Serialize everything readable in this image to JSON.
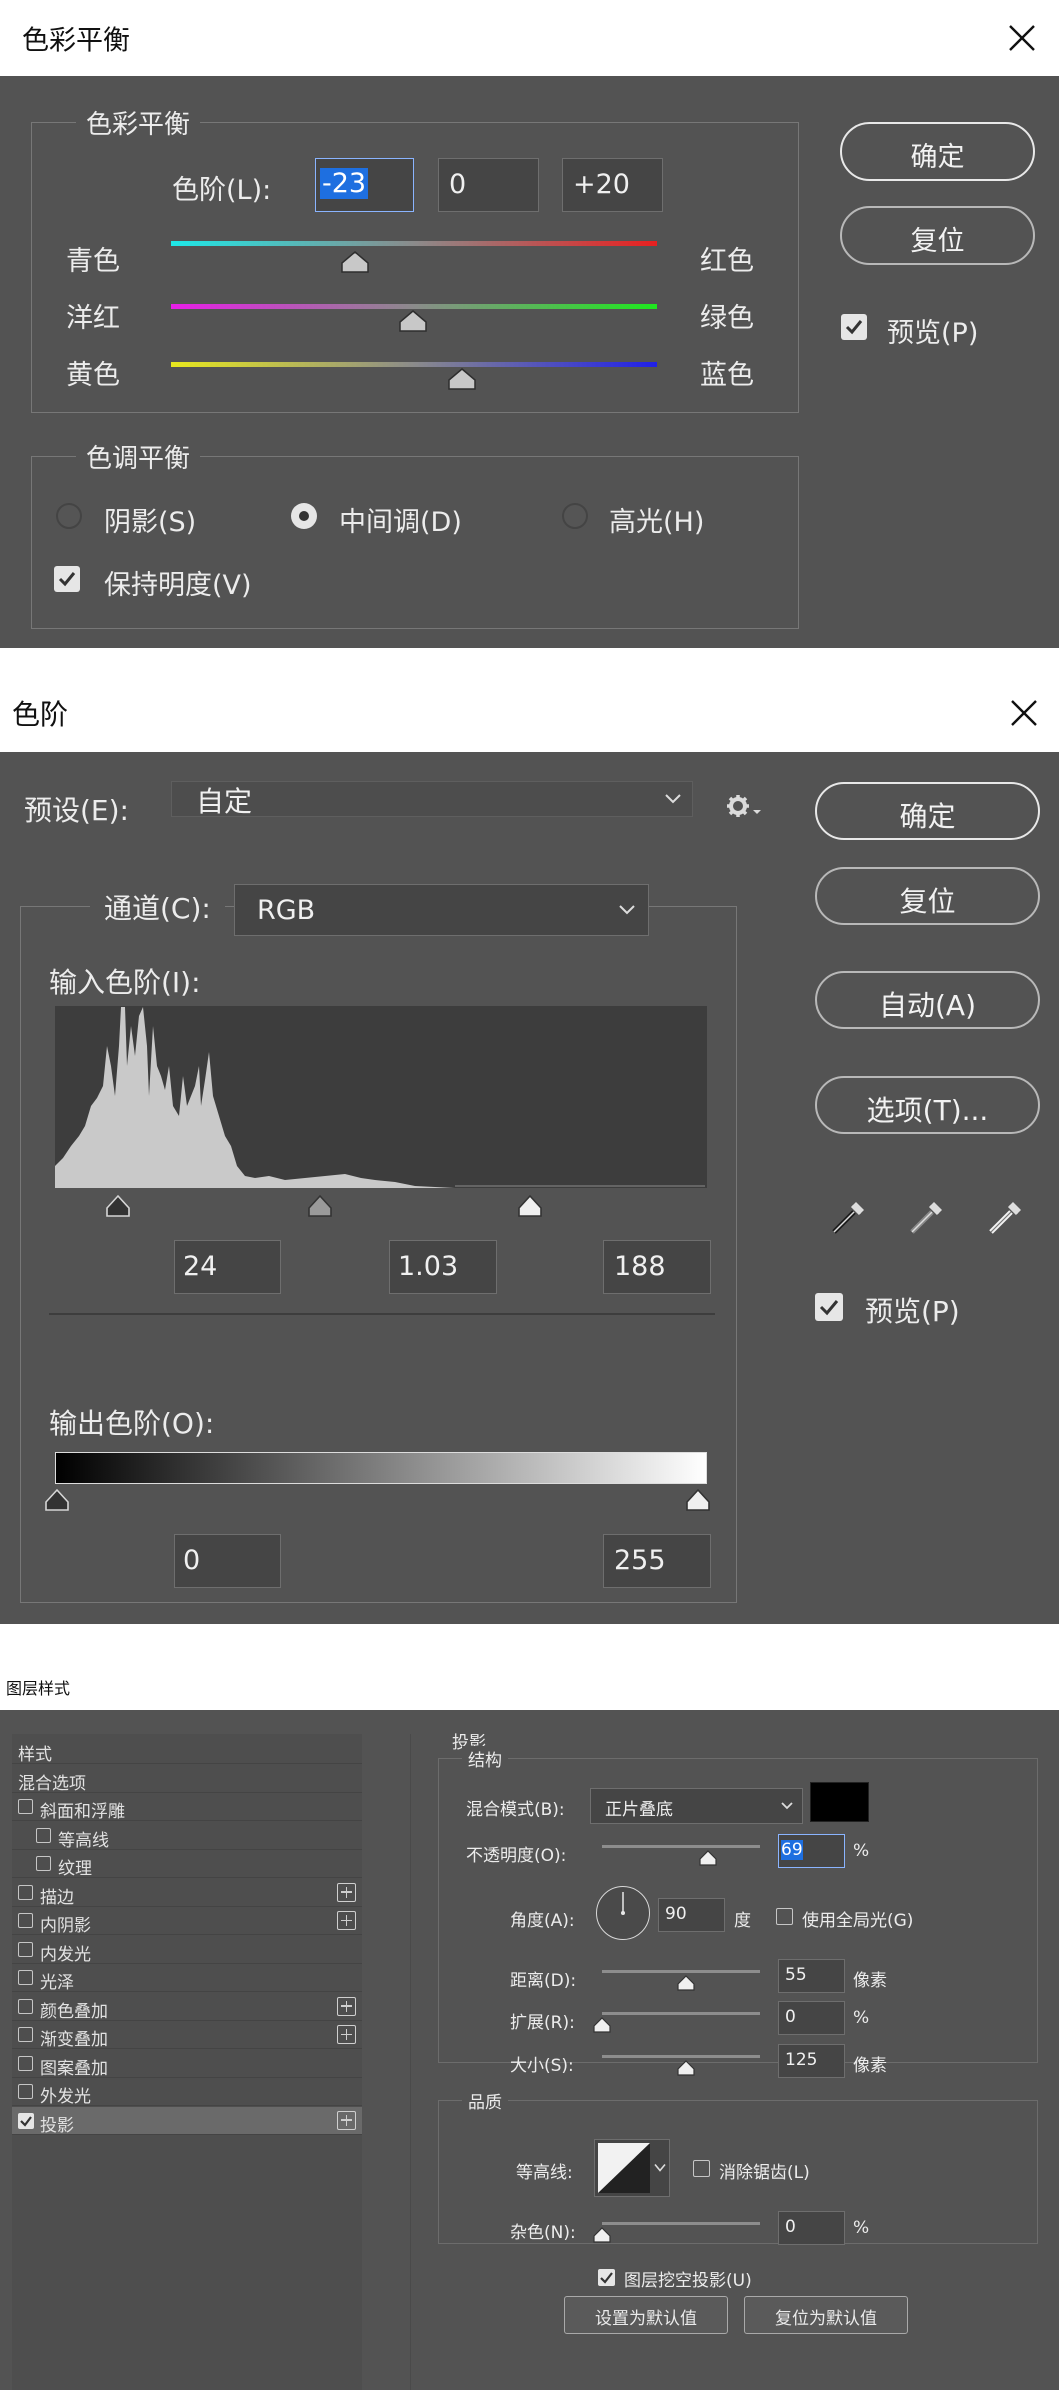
{
  "color_balance": {
    "title": "色彩平衡",
    "group_balance": "色彩平衡",
    "levels_label": "色阶(L):",
    "levels_values": [
      "-23",
      "0",
      "+20"
    ],
    "sliders": [
      {
        "left": "青色",
        "right": "红色",
        "value": -23
      },
      {
        "left": "洋红",
        "right": "绿色",
        "value": 0
      },
      {
        "left": "黄色",
        "right": "蓝色",
        "value": 20
      }
    ],
    "group_tone": "色调平衡",
    "tones": [
      "阴影(S)",
      "中间调(D)",
      "高光(H)"
    ],
    "selected_tone": "中间调(D)",
    "preserve_luminosity": "保持明度(V)",
    "buttons": {
      "ok": "确定",
      "reset": "复位"
    },
    "preview": "预览(P)",
    "colors": {
      "cyan": "#1ee8e8",
      "red": "#e82020",
      "magenta": "#e81ee8",
      "green": "#1ee81e",
      "yellow": "#e8e81e",
      "blue": "#2020e8"
    }
  },
  "levels": {
    "title": "色阶",
    "preset_label": "预设(E):",
    "preset_value": "自定",
    "channel_label": "通道(C):",
    "channel_value": "RGB",
    "input_label": "输入色阶(I):",
    "input_values": [
      "24",
      "1.03",
      "188"
    ],
    "output_label": "输出色阶(O):",
    "output_values": [
      "0",
      "255"
    ],
    "buttons": {
      "ok": "确定",
      "reset": "复位",
      "auto": "自动(A)",
      "options": "选项(T)..."
    },
    "preview": "预览(P)",
    "icons": [
      "gear-icon",
      "black-eyedropper-icon",
      "gray-eyedropper-icon",
      "white-eyedropper-icon"
    ]
  },
  "layer_style": {
    "title": "图层样式",
    "style_list": [
      {
        "label": "样式",
        "checkbox": false,
        "plus": false,
        "indent": false
      },
      {
        "label": "混合选项",
        "checkbox": false,
        "plus": false,
        "indent": false
      },
      {
        "label": "斜面和浮雕",
        "checkbox": true,
        "checked": false,
        "plus": false,
        "indent": false
      },
      {
        "label": "等高线",
        "checkbox": true,
        "checked": false,
        "plus": false,
        "indent": true
      },
      {
        "label": "纹理",
        "checkbox": true,
        "checked": false,
        "plus": false,
        "indent": true
      },
      {
        "label": "描边",
        "checkbox": true,
        "checked": false,
        "plus": true,
        "indent": false
      },
      {
        "label": "内阴影",
        "checkbox": true,
        "checked": false,
        "plus": true,
        "indent": false
      },
      {
        "label": "内发光",
        "checkbox": true,
        "checked": false,
        "plus": false,
        "indent": false
      },
      {
        "label": "光泽",
        "checkbox": true,
        "checked": false,
        "plus": false,
        "indent": false
      },
      {
        "label": "颜色叠加",
        "checkbox": true,
        "checked": false,
        "plus": true,
        "indent": false
      },
      {
        "label": "渐变叠加",
        "checkbox": true,
        "checked": false,
        "plus": true,
        "indent": false
      },
      {
        "label": "图案叠加",
        "checkbox": true,
        "checked": false,
        "plus": false,
        "indent": false
      },
      {
        "label": "外发光",
        "checkbox": true,
        "checked": false,
        "plus": false,
        "indent": false
      },
      {
        "label": "投影",
        "checkbox": true,
        "checked": true,
        "plus": true,
        "indent": false,
        "selected": true
      }
    ],
    "section_title": "投影",
    "structure_title": "结构",
    "blend_mode_label": "混合模式(B):",
    "blend_mode_value": "正片叠底",
    "shadow_color": "#000000",
    "opacity_label": "不透明度(O):",
    "opacity_value": "69",
    "angle_label": "角度(A):",
    "angle_value": "90",
    "angle_unit": "度",
    "global_light_label": "使用全局光(G)",
    "distance_label": "距离(D):",
    "distance_value": "55",
    "spread_label": "扩展(R):",
    "spread_value": "0",
    "size_label": "大小(S):",
    "size_value": "125",
    "unit_percent": "%",
    "unit_pixel": "像素",
    "quality_title": "品质",
    "contour_label": "等高线:",
    "antialias_label": "消除锯齿(L)",
    "noise_label": "杂色(N):",
    "noise_value": "0",
    "knockout_label": "图层挖空投影(U)",
    "make_default": "设置为默认值",
    "reset_default": "复位为默认值"
  }
}
